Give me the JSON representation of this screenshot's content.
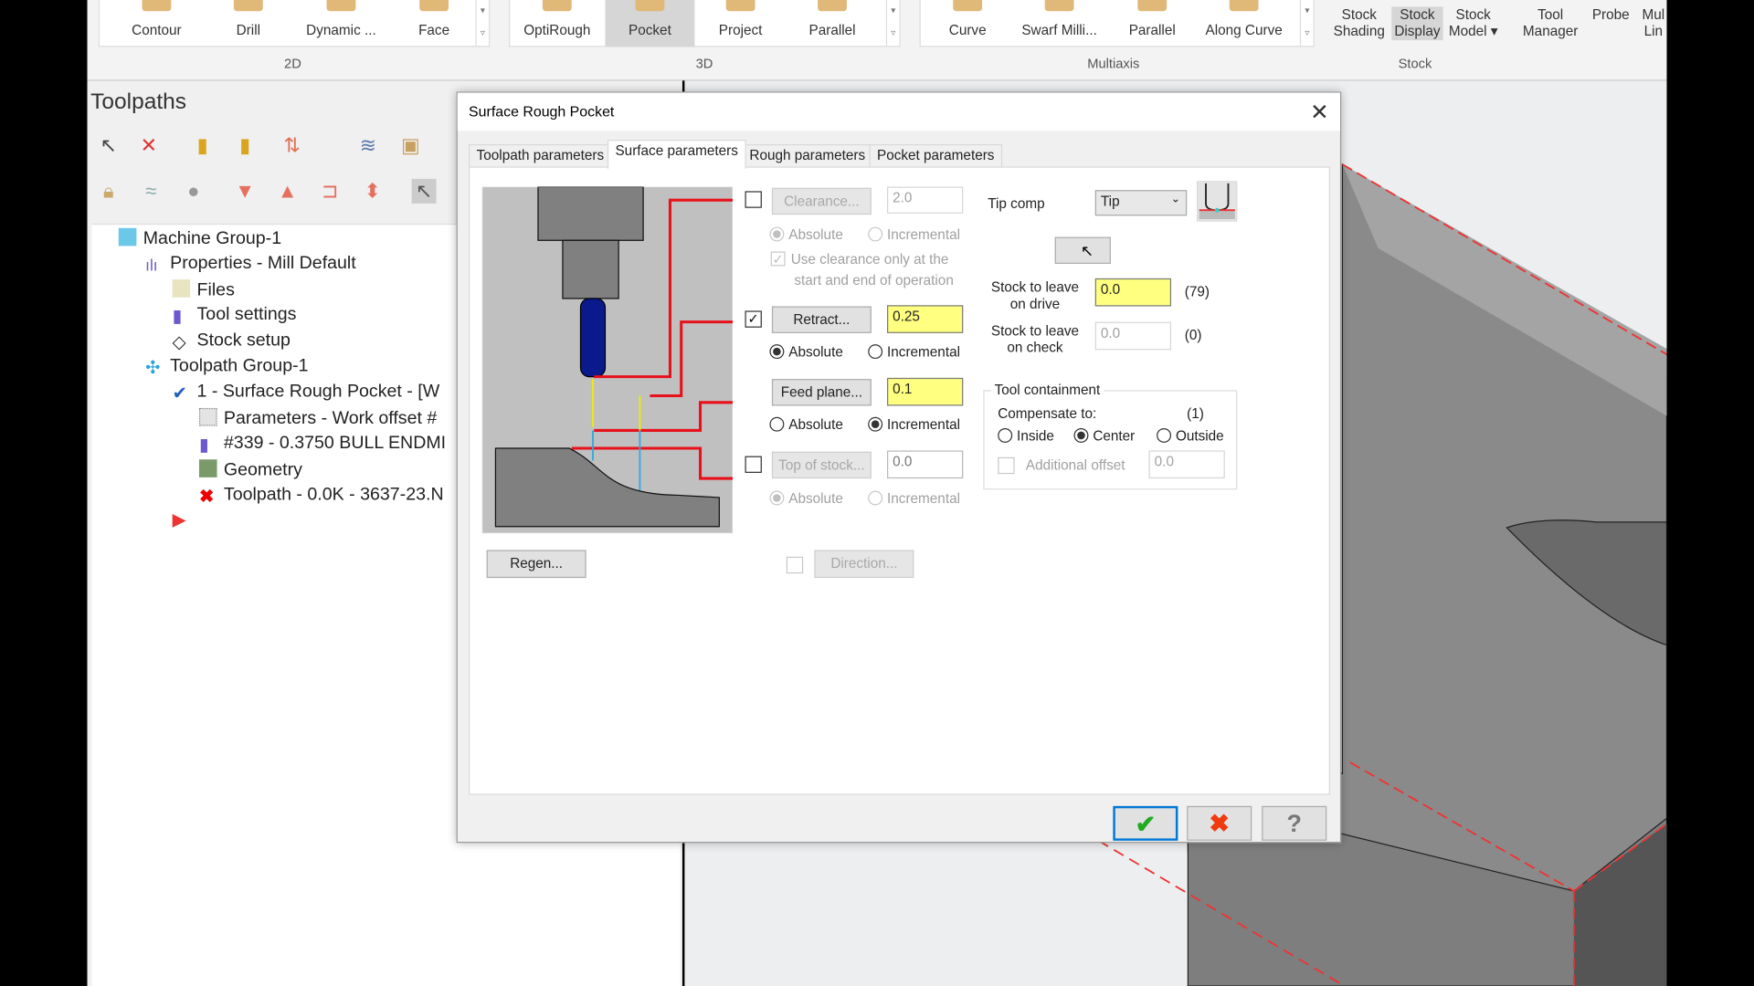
{
  "ribbon": {
    "groups": [
      {
        "label": "2D"
      },
      {
        "label": "3D"
      },
      {
        "label": "Multiaxis"
      },
      {
        "label": "Stock"
      }
    ],
    "g2d": [
      "Contour",
      "Drill",
      "Dynamic ...",
      "Face"
    ],
    "g3d": [
      "OptiRough",
      "Pocket",
      "Project",
      "Parallel"
    ],
    "gmulti": [
      "Curve",
      "Swarf Milli...",
      "Parallel",
      "Along Curve"
    ],
    "stock": [
      {
        "l1": "Stock",
        "l2": "Shading"
      },
      {
        "l1": "Stock",
        "l2": "Display"
      },
      {
        "l1": "Stock",
        "l2": "Model ▾"
      }
    ],
    "other": [
      {
        "l1": "Tool",
        "l2": "Manager"
      },
      {
        "l1": "Probe",
        "l2": ""
      },
      {
        "l1": "Mul",
        "l2": "Lin"
      }
    ],
    "selected": [
      "Pocket",
      "Stock Display"
    ]
  },
  "toolpaths": {
    "title": "Toolpaths",
    "tree": [
      {
        "label": "Machine Group-1",
        "icon": "machine-group-icon"
      },
      {
        "label": "Properties - Mill Default",
        "icon": "properties-icon"
      },
      {
        "label": "Files",
        "icon": "folder-icon"
      },
      {
        "label": "Tool settings",
        "icon": "tool-icon"
      },
      {
        "label": "Stock setup",
        "icon": "stock-icon"
      },
      {
        "label": "Toolpath Group-1",
        "icon": "toolpath-group-icon"
      },
      {
        "label": "1 - Surface Rough Pocket - [W",
        "icon": "operation-check-icon"
      },
      {
        "label": "Parameters - Work offset #",
        "icon": "parameters-icon"
      },
      {
        "label": "#339 - 0.3750 BULL ENDMI",
        "icon": "tool-icon"
      },
      {
        "label": "Geometry",
        "icon": "geometry-icon"
      },
      {
        "label": "Toolpath - 0.0K - 3637-23.N",
        "icon": "dirty-toolpath-icon"
      }
    ]
  },
  "dialog": {
    "title": "Surface Rough Pocket",
    "tabs": [
      "Toolpath parameters",
      "Surface parameters",
      "Rough parameters",
      "Pocket parameters"
    ],
    "active_tab": "Surface parameters",
    "clearance": {
      "label": "Clearance...",
      "value": "2.0",
      "enabled": false,
      "abs": "Absolute",
      "inc": "Incremental",
      "use_only_l1": "Use clearance only at the",
      "use_only_l2": "start and end of operation"
    },
    "retract": {
      "label": "Retract...",
      "value": "0.25",
      "checked": true,
      "abs": "Absolute",
      "inc": "Incremental",
      "mode": "Absolute"
    },
    "feed": {
      "label": "Feed plane...",
      "value": "0.1",
      "abs": "Absolute",
      "inc": "Incremental",
      "mode": "Incremental"
    },
    "top": {
      "label": "Top of stock...",
      "value": "0.0",
      "checked": false,
      "abs": "Absolute",
      "inc": "Incremental"
    },
    "regen": "Regen...",
    "direction": "Direction...",
    "tipcomp": {
      "label": "Tip comp",
      "value": "Tip"
    },
    "drive": {
      "l1": "Stock to leave",
      "l2": "on drive",
      "value": "0.0",
      "count": "(79)"
    },
    "check": {
      "l1": "Stock to leave",
      "l2": "on check",
      "value": "0.0",
      "count": "(0)"
    },
    "containment": {
      "title": "Tool containment",
      "compensate": "Compensate to:",
      "count": "(1)",
      "inside": "Inside",
      "center": "Center",
      "outside": "Outside",
      "selected": "Center",
      "addl": "Additional offset",
      "addl_value": "0.0"
    },
    "ok_icon": "check-icon",
    "cancel_icon": "x-icon",
    "help_icon": "question-icon"
  },
  "colors": {
    "accent": "#0078d7",
    "yellow_field": "#ffff80",
    "toolpath_red": "#e8101a"
  }
}
